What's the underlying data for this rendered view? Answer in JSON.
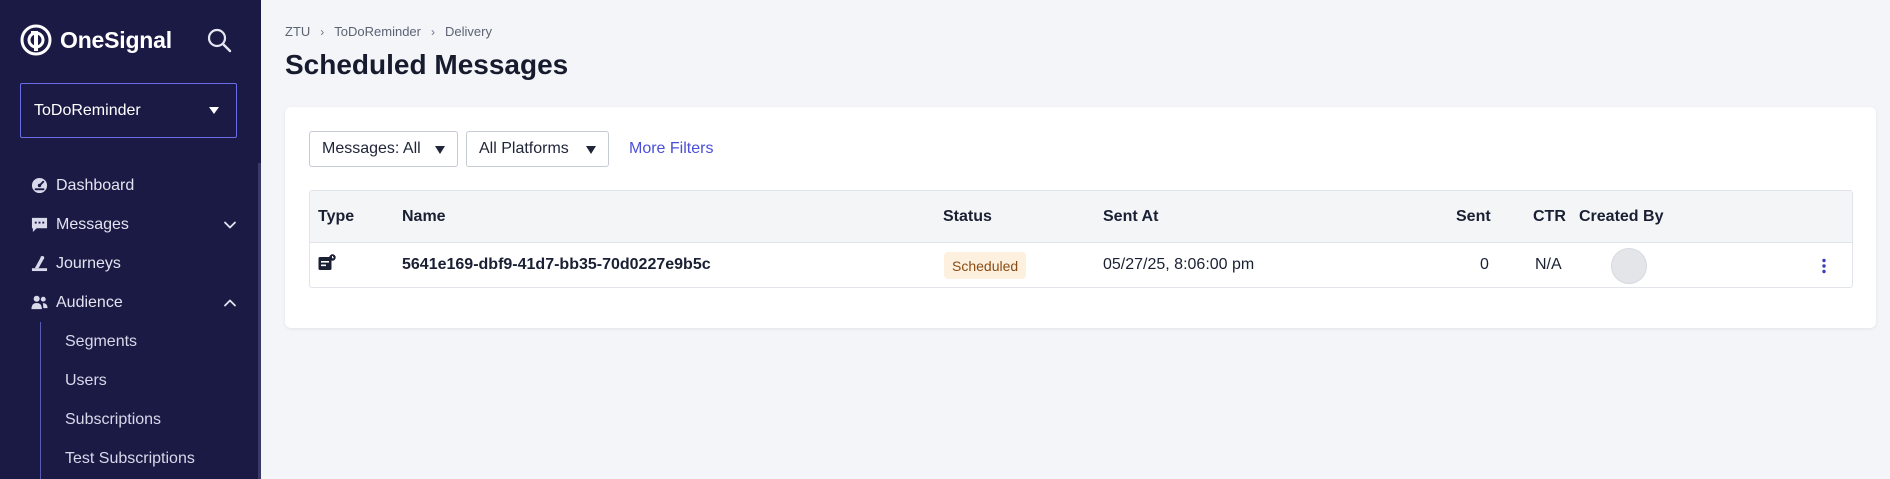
{
  "sidebar": {
    "brand": "OneSignal",
    "app_selector": {
      "value": "ToDoReminder"
    },
    "nav": [
      {
        "label": "Dashboard",
        "icon": "dashboard-icon"
      },
      {
        "label": "Messages",
        "icon": "messages-icon",
        "expandable": true,
        "expanded": false
      },
      {
        "label": "Journeys",
        "icon": "journeys-icon"
      },
      {
        "label": "Audience",
        "icon": "audience-icon",
        "expandable": true,
        "expanded": true
      }
    ],
    "audience_subitems": [
      "Segments",
      "Users",
      "Subscriptions",
      "Test Subscriptions"
    ]
  },
  "breadcrumb": [
    "ZTU",
    "ToDoReminder",
    "Delivery"
  ],
  "page_title": "Scheduled Messages",
  "filters": {
    "messages": "Messages: All",
    "platforms": "All Platforms",
    "more": "More Filters"
  },
  "table": {
    "columns": {
      "type": "Type",
      "name": "Name",
      "status": "Status",
      "sent_at": "Sent At",
      "sent": "Sent",
      "ctr": "CTR",
      "created_by": "Created By"
    },
    "rows": [
      {
        "type_icon": "message-schedule-icon",
        "name": "5641e169-dbf9-41d7-bb35-70d0227e9b5c",
        "status": "Scheduled",
        "sent_at": "05/27/25, 8:06:00 pm",
        "sent": "0",
        "ctr": "N/A"
      }
    ]
  },
  "colors": {
    "sidebar_bg": "#1b1a45",
    "accent": "#4b4fd6",
    "status_scheduled_bg": "#fdf0df",
    "status_scheduled_text": "#8a4b12"
  }
}
